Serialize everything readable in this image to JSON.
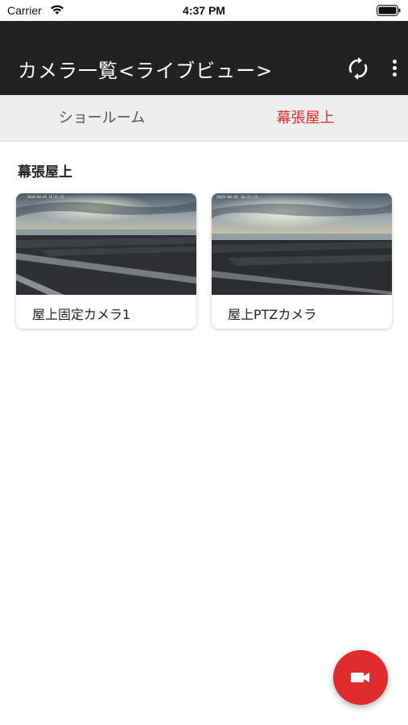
{
  "status_bar": {
    "carrier": "Carrier",
    "time": "4:37 PM"
  },
  "app_bar": {
    "title": "カメラ一覧<ライブビュー>",
    "refresh_icon": "refresh-icon",
    "more_icon": "more-vertical-icon",
    "background": "#222222"
  },
  "tabs": [
    {
      "label": "ショールーム",
      "active": false
    },
    {
      "label": "幕張屋上",
      "active": true
    }
  ],
  "section": {
    "title": "幕張屋上",
    "cameras": [
      {
        "name": "屋上固定カメラ1",
        "thumbnail_timestamp": "2019-08-05 16:37:25"
      },
      {
        "name": "屋上PTZカメラ",
        "thumbnail_timestamp": "2019-08-05 16:37:25"
      }
    ]
  },
  "fab": {
    "icon": "video-camera-icon",
    "color": "#e02c2c"
  },
  "colors": {
    "accent": "#e02c2c",
    "tab_bar": "#eeeeee"
  }
}
